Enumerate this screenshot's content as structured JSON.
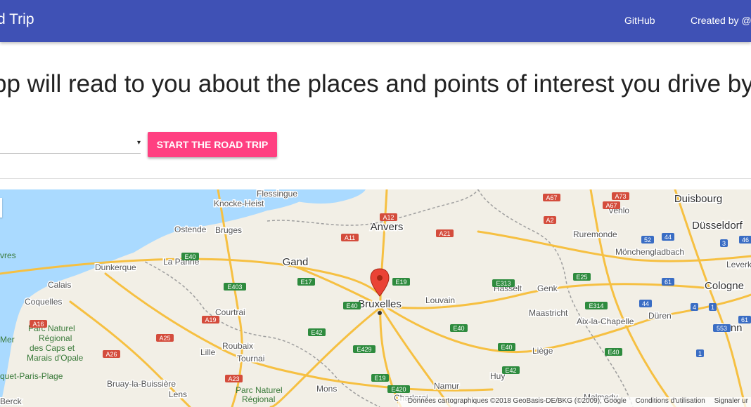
{
  "appbar": {
    "title": "d Trip",
    "github": "GitHub",
    "created_by": "Created by @"
  },
  "tagline": "pp will read to you about the places and points of interest you drive by",
  "controls": {
    "start_button": "START THE ROAD TRIP",
    "select_arrow": "▾"
  },
  "map": {
    "cities": [
      {
        "name": "Anvers",
        "big": true
      },
      {
        "name": "Gand",
        "big": true
      },
      {
        "name": "Bruxelles",
        "big": true
      },
      {
        "name": "Duisbourg",
        "big": true
      },
      {
        "name": "Düsseldorf",
        "big": true
      },
      {
        "name": "Cologne",
        "big": true
      },
      {
        "name": "Bonn",
        "big": true
      },
      {
        "name": "Flessingue",
        "big": false
      },
      {
        "name": "Knocke-Heist",
        "big": false
      },
      {
        "name": "Ostende",
        "big": false
      },
      {
        "name": "Bruges",
        "big": false
      },
      {
        "name": "Dunkerque",
        "big": false
      },
      {
        "name": "La Panne",
        "big": false
      },
      {
        "name": "Calais",
        "big": false
      },
      {
        "name": "Coquelles",
        "big": false
      },
      {
        "name": "Courtrai",
        "big": false
      },
      {
        "name": "Lille",
        "big": false
      },
      {
        "name": "Roubaix",
        "big": false
      },
      {
        "name": "Tournai",
        "big": false
      },
      {
        "name": "Louvain",
        "big": false
      },
      {
        "name": "Hasselt",
        "big": false
      },
      {
        "name": "Genk",
        "big": false
      },
      {
        "name": "Maastricht",
        "big": false
      },
      {
        "name": "Aix-la-Chapelle",
        "big": false
      },
      {
        "name": "Düren",
        "big": false
      },
      {
        "name": "Liège",
        "big": false
      },
      {
        "name": "Huy",
        "big": false
      },
      {
        "name": "Namur",
        "big": false
      },
      {
        "name": "Charleroi",
        "big": false
      },
      {
        "name": "Mons",
        "big": false
      },
      {
        "name": "Venlo",
        "big": false
      },
      {
        "name": "Ruremonde",
        "big": false
      },
      {
        "name": "Mönchengladbach",
        "big": false
      },
      {
        "name": "Leverkuse",
        "big": false
      },
      {
        "name": "Bruay-la-Buissière",
        "big": false
      },
      {
        "name": "Lens",
        "big": false
      },
      {
        "name": "Berck",
        "big": false
      },
      {
        "name": "Malmedy",
        "big": false
      }
    ],
    "regions": [
      "Parc Naturel",
      "Régional",
      "des Caps et",
      "Marais d'Opale",
      "Parc Naturel",
      "Régional",
      "quet-Paris-Plage",
      "Mer",
      "vres"
    ],
    "shields": [
      "A67",
      "A73",
      "A67",
      "A2",
      "A12",
      "A11",
      "A21",
      "E40",
      "E403",
      "E17",
      "E19",
      "E40",
      "E313",
      "E25",
      "E314",
      "E40",
      "E40",
      "A19",
      "A16",
      "A25",
      "A26",
      "E429",
      "A23",
      "E42",
      "E42",
      "E19",
      "E420",
      "E40",
      "52",
      "44",
      "3",
      "46",
      "61",
      "44",
      "4",
      "1",
      "553",
      "61",
      "1"
    ],
    "attribution": "Données cartographiques ©2018 GeoBasis-DE/BKG (©2009), Google",
    "terms": "Conditions d'utilisation",
    "report": "Signaler ur"
  }
}
